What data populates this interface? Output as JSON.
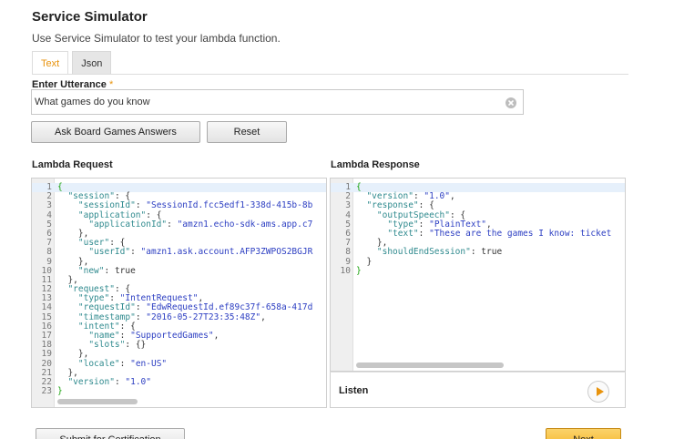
{
  "page": {
    "title": "Service Simulator",
    "subtitle": "Use Service Simulator to test your lambda function."
  },
  "tabs": [
    {
      "label": "Text",
      "active": true
    },
    {
      "label": "Json",
      "active": false
    }
  ],
  "utterance": {
    "label": "Enter Utterance",
    "required_mark": "*",
    "value": "What games do you know",
    "clear_icon": "clear-circle-icon"
  },
  "buttons": {
    "ask": "Ask Board Games Answers",
    "reset": "Reset",
    "submit": "Submit for Certification",
    "next": "Next"
  },
  "lambda_request": {
    "label": "Lambda Request",
    "lines": [
      {
        "n": "1",
        "t": "{"
      },
      {
        "n": "2",
        "t": "  \"session\": {"
      },
      {
        "n": "3",
        "t": "    \"sessionId\": \"SessionId.fcc5edf1-338d-415b-8b"
      },
      {
        "n": "4",
        "t": "    \"application\": {"
      },
      {
        "n": "5",
        "t": "      \"applicationId\": \"amzn1.echo-sdk-ams.app.c7"
      },
      {
        "n": "6",
        "t": "    },"
      },
      {
        "n": "7",
        "t": "    \"user\": {"
      },
      {
        "n": "8",
        "t": "      \"userId\": \"amzn1.ask.account.AFP3ZWPOS2BGJR"
      },
      {
        "n": "9",
        "t": "    },"
      },
      {
        "n": "10",
        "t": "    \"new\": true"
      },
      {
        "n": "11",
        "t": "  },"
      },
      {
        "n": "12",
        "t": "  \"request\": {"
      },
      {
        "n": "13",
        "t": "    \"type\": \"IntentRequest\","
      },
      {
        "n": "14",
        "t": "    \"requestId\": \"EdwRequestId.ef89c37f-658a-417d"
      },
      {
        "n": "15",
        "t": "    \"timestamp\": \"2016-05-27T23:35:48Z\","
      },
      {
        "n": "16",
        "t": "    \"intent\": {"
      },
      {
        "n": "17",
        "t": "      \"name\": \"SupportedGames\","
      },
      {
        "n": "18",
        "t": "      \"slots\": {}"
      },
      {
        "n": "19",
        "t": "    },"
      },
      {
        "n": "20",
        "t": "    \"locale\": \"en-US\""
      },
      {
        "n": "21",
        "t": "  },"
      },
      {
        "n": "22",
        "t": "  \"version\": \"1.0\""
      },
      {
        "n": "23",
        "t": "}"
      }
    ]
  },
  "lambda_response": {
    "label": "Lambda Response",
    "lines": [
      {
        "n": "1",
        "t": "{"
      },
      {
        "n": "2",
        "t": "  \"version\": \"1.0\","
      },
      {
        "n": "3",
        "t": "  \"response\": {"
      },
      {
        "n": "4",
        "t": "    \"outputSpeech\": {"
      },
      {
        "n": "5",
        "t": "      \"type\": \"PlainText\","
      },
      {
        "n": "6",
        "t": "      \"text\": \"These are the games I know: ticket"
      },
      {
        "n": "7",
        "t": "    },"
      },
      {
        "n": "8",
        "t": "    \"shouldEndSession\": true"
      },
      {
        "n": "9",
        "t": "  }"
      },
      {
        "n": "10",
        "t": "}"
      }
    ]
  },
  "listen": {
    "label": "Listen",
    "icon": "play-icon"
  },
  "colors": {
    "accent": "#e8930c",
    "json_key": "#2f8a8e",
    "json_string": "#2c3ec2",
    "brace": "#1ca30f",
    "next_button": "#f4b324"
  }
}
